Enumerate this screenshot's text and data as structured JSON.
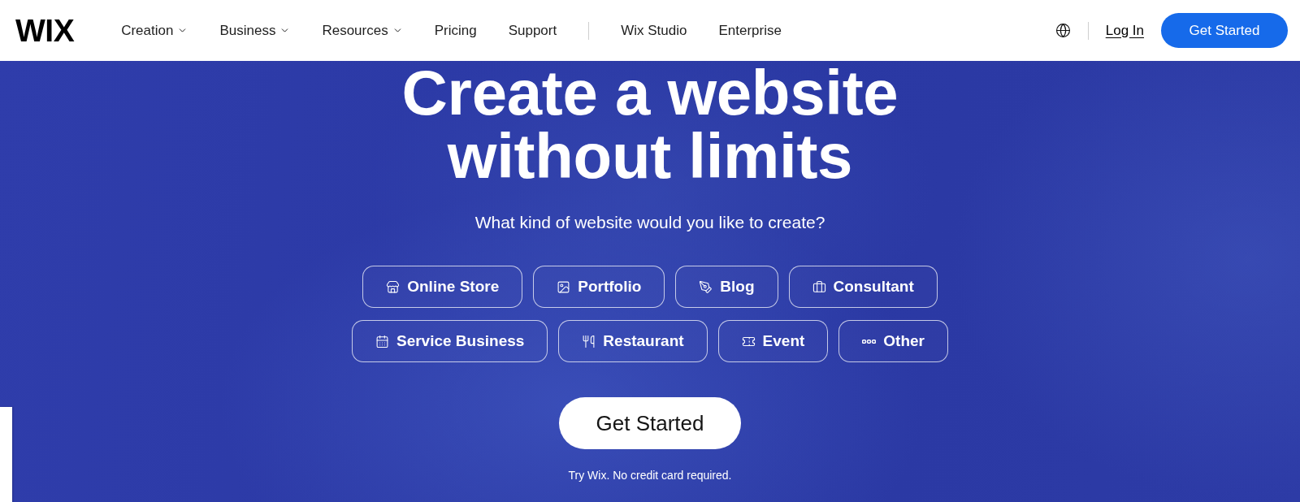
{
  "nav": {
    "logo": "WIX",
    "menu": [
      {
        "label": "Creation",
        "dropdown": true
      },
      {
        "label": "Business",
        "dropdown": true
      },
      {
        "label": "Resources",
        "dropdown": true
      },
      {
        "label": "Pricing",
        "dropdown": false
      },
      {
        "label": "Support",
        "dropdown": false
      }
    ],
    "menu_secondary": [
      {
        "label": "Wix Studio",
        "dropdown": false
      },
      {
        "label": "Enterprise",
        "dropdown": false
      }
    ],
    "login": "Log In",
    "cta": "Get Started"
  },
  "hero": {
    "title": "Create a website without limits",
    "subtitle": "What kind of website would you like to create?",
    "site_type_rows": [
      [
        "Online Store",
        "Portfolio",
        "Blog",
        "Consultant"
      ],
      [
        "Service Business",
        "Restaurant",
        "Event",
        "Other"
      ]
    ],
    "cta": "Get Started",
    "note": "Try Wix. No credit card required."
  }
}
